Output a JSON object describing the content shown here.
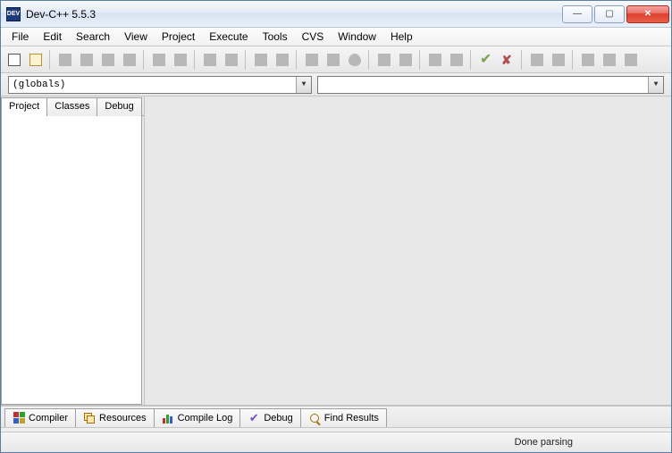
{
  "titlebar": {
    "title": "Dev-C++ 5.5.3",
    "icon_label": "DEV"
  },
  "menu": [
    "File",
    "Edit",
    "Search",
    "View",
    "Project",
    "Execute",
    "Tools",
    "CVS",
    "Window",
    "Help"
  ],
  "toolbar_groups": [
    [
      "new-file-icon",
      "new-project-icon"
    ],
    [
      "open-icon",
      "save-icon",
      "save-all-icon",
      "close-icon"
    ],
    [
      "undo-icon",
      "redo-icon"
    ],
    [
      "find-icon",
      "replace-icon"
    ],
    [
      "compile-icon",
      "run-icon"
    ],
    [
      "debug-icon",
      "stop-debug-icon",
      "shield-icon"
    ],
    [
      "grid-a-icon",
      "grid-b-icon"
    ],
    [
      "block-a-icon",
      "block-b-icon"
    ],
    [
      "check-icon",
      "cross-icon"
    ],
    [
      "pkg-a-icon",
      "pkg-b-icon"
    ],
    [
      "toggle-a-icon",
      "toggle-b-icon",
      "toggle-c-icon"
    ]
  ],
  "combos": {
    "scope": "(globals)",
    "members": ""
  },
  "side_tabs": [
    {
      "id": "project",
      "label": "Project",
      "active": true
    },
    {
      "id": "classes",
      "label": "Classes",
      "active": false
    },
    {
      "id": "debug",
      "label": "Debug",
      "active": false
    }
  ],
  "bottom_tabs": [
    {
      "id": "compiler",
      "label": "Compiler",
      "icon": "grid",
      "color": "#c00"
    },
    {
      "id": "resources",
      "label": "Resources",
      "icon": "copy",
      "color": "#c07000"
    },
    {
      "id": "compile-log",
      "label": "Compile Log",
      "icon": "bars",
      "color": "#2060c0"
    },
    {
      "id": "debug",
      "label": "Debug",
      "icon": "check",
      "color": "#7050c0"
    },
    {
      "id": "find-results",
      "label": "Find Results",
      "icon": "search",
      "color": "#c09000"
    }
  ],
  "status": {
    "text": "Done parsing"
  }
}
